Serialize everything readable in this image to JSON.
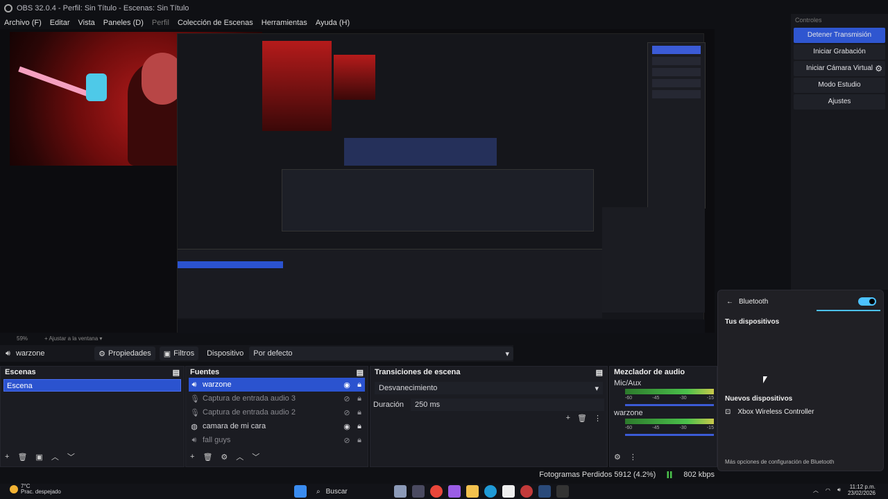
{
  "window": {
    "title": "OBS 32.0.4 - Perfil: Sin Título - Escenas: Sin Título"
  },
  "menu": [
    "Archivo (F)",
    "Editar",
    "Vista",
    "Paneles (D)",
    "Perfil",
    "Colección de Escenas",
    "Herramientas",
    "Ayuda (H)"
  ],
  "zoom": {
    "level": "59%",
    "fit": "Ajustar a la ventana"
  },
  "context": {
    "source": "warzone",
    "properties": "Propiedades",
    "filters": "Filtros",
    "device_label": "Dispositivo",
    "device_value": "Por defecto"
  },
  "scenes": {
    "title": "Escenas",
    "items": [
      "Escena"
    ]
  },
  "sources": {
    "title": "Fuentes",
    "items": [
      {
        "name": "warzone",
        "icon": "speaker-icon",
        "visible": true,
        "selected": true
      },
      {
        "name": "Captura de entrada audio 3",
        "icon": "mic-icon",
        "visible": false
      },
      {
        "name": "Captura de entrada audio 2",
        "icon": "mic-icon",
        "visible": false
      },
      {
        "name": "camara de mi cara",
        "icon": "camera-icon",
        "visible": true
      },
      {
        "name": "fall guys",
        "icon": "speaker-icon",
        "visible": false
      }
    ]
  },
  "transitions": {
    "title": "Transiciones de escena",
    "type": "Desvanecimiento",
    "duration_label": "Duración",
    "duration": "250 ms"
  },
  "mixer": {
    "title": "Mezclador de audio",
    "channels": [
      {
        "name": "Mic/Aux"
      },
      {
        "name": "warzone"
      }
    ],
    "scale": [
      "-60",
      "-45",
      "-30",
      "-15"
    ]
  },
  "status": {
    "dropped": "Fotogramas Perdidos 5912 (4.2%)",
    "bitrate": "802 kbps"
  },
  "controls": {
    "title": "Controles",
    "buttons": [
      "Detener Transmisión",
      "Iniciar Grabación",
      "Iniciar Cámara Virtual",
      "Modo Estudio",
      "Ajustes"
    ]
  },
  "bluetooth": {
    "title": "Bluetooth",
    "yours": "Tus dispositivos",
    "new": "Nuevos dispositivos",
    "device": "Xbox Wireless Controller",
    "more": "Más opciones de configuración de Bluetooth"
  },
  "taskbar": {
    "temp": "7°C",
    "weather": "Prac. despejado",
    "search": "Buscar",
    "time": "11:12 p.m.",
    "date": "23/02/2026"
  },
  "colors": {
    "accent": "#2b53cf",
    "bt": "#4cc2ff"
  }
}
